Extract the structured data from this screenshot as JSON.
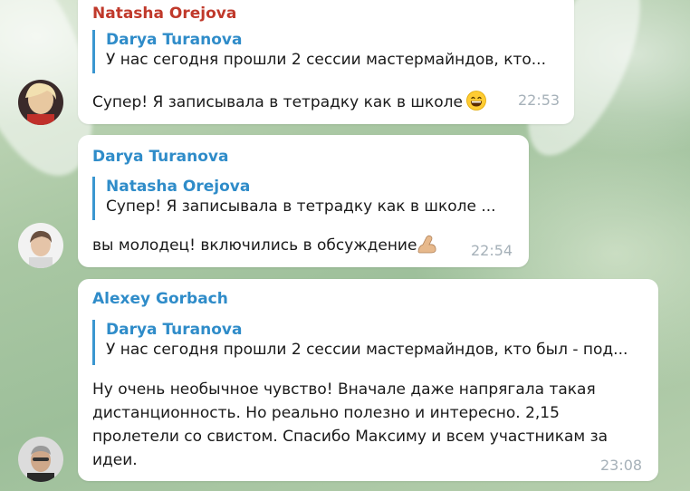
{
  "messages": [
    {
      "sender": "Natasha Orejova",
      "sender_color": "#c0392b",
      "reply_to": {
        "name": "Darya Turanova",
        "text": "У нас сегодня прошли 2 сессии мастермайндов, кто..."
      },
      "text": "Супер! Я записывала в тетрадку как в школе",
      "emoji": "grinning-face-emoji",
      "time": "22:53"
    },
    {
      "sender": "Darya Turanova",
      "sender_color": "#2f8cc9",
      "reply_to": {
        "name": "Natasha Orejova",
        "text": "Супер! Я записывала в тетрадку как в школе ..."
      },
      "text": "вы молодец! включились в обсуждение",
      "emoji": "flexed-biceps-emoji",
      "time": "22:54"
    },
    {
      "sender": "Alexey Gorbach",
      "sender_color": "#2f8cc9",
      "reply_to": {
        "name": "Darya Turanova",
        "text": "У нас сегодня прошли 2 сессии мастермайндов, кто был - под..."
      },
      "text": "Ну очень необычное чувство! Вначале даже напрягала такая дистанционность. Но реально полезно и интересно. 2,15 пролетели со свистом. Спасибо Максиму и всем участникам за идеи.",
      "time": "23:08"
    }
  ],
  "colors": {
    "reply_bar": "#3a96d0",
    "time": "#a6b1b9",
    "bubble": "#ffffff"
  }
}
